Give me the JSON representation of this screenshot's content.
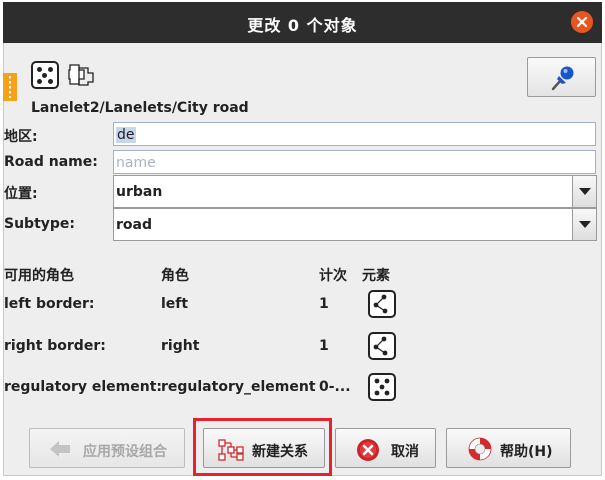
{
  "window": {
    "title": "更改 0 个对象"
  },
  "preset": {
    "path": "Lanelet2/Lanelets/City road"
  },
  "fields": [
    {
      "label": "地区:",
      "value": "de",
      "placeholder": ""
    },
    {
      "label": "Road name:",
      "value": "",
      "placeholder": "name"
    },
    {
      "label": "位置:",
      "value": "urban"
    },
    {
      "label": "Subtype:",
      "value": "road"
    }
  ],
  "members": {
    "headers": {
      "roles_available": "可用的角色",
      "role": "角色",
      "count": "计次",
      "elements": "元素"
    },
    "rows": [
      {
        "name": "left border:",
        "role": "left",
        "count": "1",
        "icon": "way-icon"
      },
      {
        "name": "right border:",
        "role": "right",
        "count": "1",
        "icon": "way-icon"
      },
      {
        "name": "regulatory element:",
        "role": "regulatory_element",
        "count": "0-...",
        "icon": "node-icon"
      }
    ]
  },
  "buttons": {
    "apply_preset": "应用预设组合",
    "new_relation": "新建关系",
    "cancel": "取消",
    "help": "帮助(H)"
  },
  "colors": {
    "titlebar": "#2d2d2d",
    "close": "#e95420",
    "highlight": "#e8212e",
    "accent_bar": "#f6a11a"
  }
}
